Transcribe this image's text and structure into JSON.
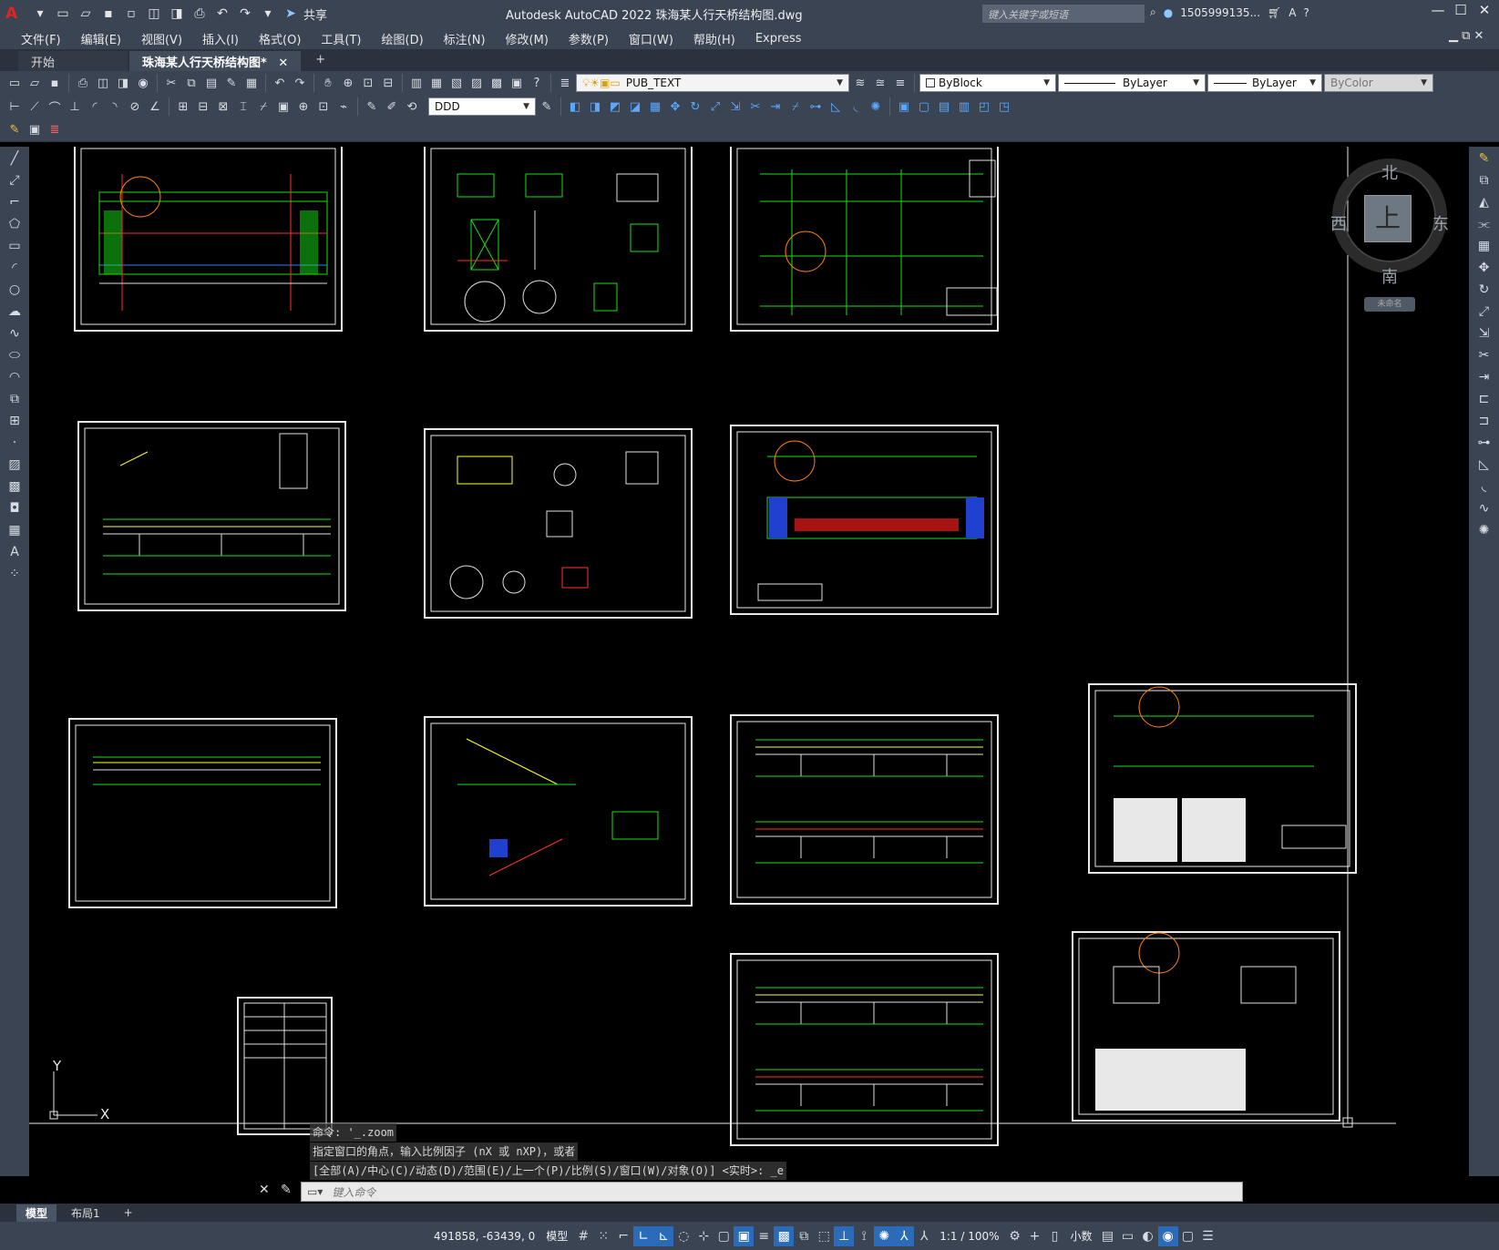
{
  "app": {
    "logo": "A",
    "title": "Autodesk AutoCAD 2022    珠海某人行天桥结构图.dwg",
    "share_label": "共享",
    "search_placeholder": "键入关键字或短语",
    "user": "1505999135...",
    "win_min": "—",
    "win_max": "☐",
    "win_close": "✕"
  },
  "menu": [
    "文件(F)",
    "编辑(E)",
    "视图(V)",
    "插入(I)",
    "格式(O)",
    "工具(T)",
    "绘图(D)",
    "标注(N)",
    "修改(M)",
    "参数(P)",
    "窗口(W)",
    "帮助(H)",
    "Express"
  ],
  "doc_tabs": {
    "start": "开始",
    "file": "珠海某人行天桥结构图*",
    "close": "✕",
    "add": "+"
  },
  "toolbar": {
    "layer": "PUB_TEXT",
    "color": "ByBlock",
    "linetype": "ByLayer",
    "lineweight": "ByLayer",
    "plotstyle": "ByColor",
    "dimstyle": "DDD"
  },
  "viewcube": {
    "north": "北",
    "south": "南",
    "east": "东",
    "west": "西",
    "face": "上",
    "ucs": "未命名"
  },
  "ucs_icon": {
    "y": "Y",
    "x": "X"
  },
  "command": {
    "history": [
      "命令: '_.zoom",
      "指定窗口的角点，输入比例因子 (nX 或 nXP)，或者",
      "[全部(A)/中心(C)/动态(D)/范围(E)/上一个(P)/比例(S)/窗口(W)/对象(O)] <实时>: _e"
    ],
    "placeholder": "键入命令"
  },
  "layout_tabs": [
    "模型",
    "布局1"
  ],
  "status": {
    "coords": "491858, -63439, 0",
    "model": "模型",
    "scale": "1:1 / 100%",
    "units": "小数"
  },
  "colors": {
    "chrome": "#3b4453",
    "canvas": "#000000",
    "drawing_green": "#18e018",
    "accent_blue": "#2c6bb8"
  }
}
